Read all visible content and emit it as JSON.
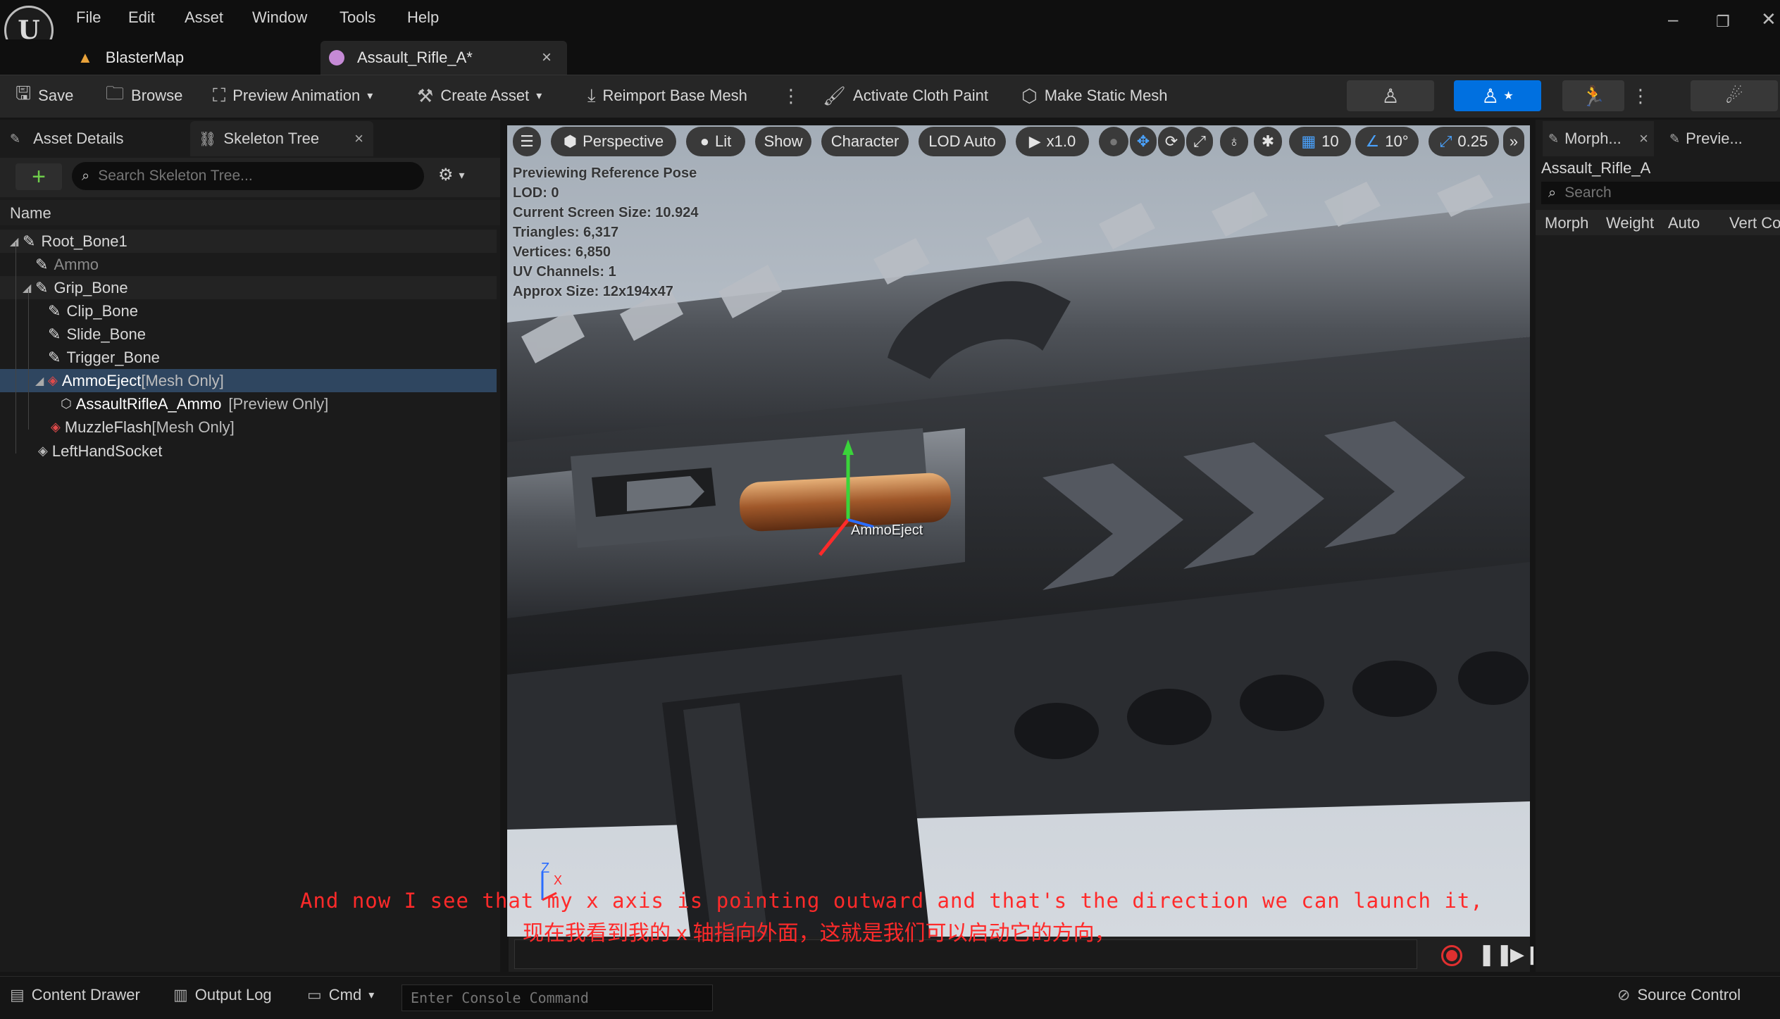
{
  "menu": [
    "File",
    "Edit",
    "Asset",
    "Window",
    "Tools",
    "Help"
  ],
  "tabs": {
    "map": "BlasterMap",
    "asset": "Assault_Rifle_A*",
    "close": "×"
  },
  "toolbar": {
    "save": "Save",
    "browse": "Browse",
    "preview_animation": "Preview Animation",
    "create_asset": "Create Asset",
    "reimport": "Reimport Base Mesh",
    "cloth_paint": "Activate Cloth Paint",
    "static_mesh": "Make Static Mesh"
  },
  "left_panel": {
    "asset_details_tab": "Asset Details",
    "skeleton_tree_tab": "Skeleton Tree",
    "search_placeholder": "Search Skeleton Tree...",
    "column_name": "Name",
    "tree": [
      {
        "label": "Root_Bone1"
      },
      {
        "label": "Ammo"
      },
      {
        "label": "Grip_Bone"
      },
      {
        "label": "Clip_Bone"
      },
      {
        "label": "Slide_Bone"
      },
      {
        "label": "Trigger_Bone"
      },
      {
        "label": "AmmoEject",
        "tag": "[Mesh Only]"
      },
      {
        "label": "AssaultRifleA_Ammo",
        "tag": "[Preview Only]"
      },
      {
        "label": "MuzzleFlash",
        "tag": "[Mesh Only]"
      },
      {
        "label": "LeftHandSocket"
      }
    ]
  },
  "viewport": {
    "toolbar": {
      "perspective": "Perspective",
      "lit": "Lit",
      "show": "Show",
      "character": "Character",
      "lod": "LOD Auto",
      "speed": "x1.0",
      "grid_snap": "10",
      "rot_snap": "10°",
      "scale_snap": "0.25"
    },
    "stats": [
      "Previewing Reference Pose",
      "LOD: 0",
      "Current Screen Size: 10.924",
      "Triangles: 6,317",
      "Vertices: 6,850",
      "UV Channels: 1",
      "Approx Size: 12x194x47"
    ],
    "gizmo_label": "AmmoEject",
    "axis_z": "Z",
    "axis_x": "X"
  },
  "subtitles": {
    "english": "And now I see that my x axis is pointing outward and that's the direction we can launch it,",
    "chinese": "现在我看到我的 x 轴指向外面，这就是我们可以启动它的方向，"
  },
  "right_panel": {
    "morph_tab": "Morph...",
    "preview_tab": "Previe...",
    "asset_name": "Assault_Rifle_A",
    "search_placeholder": "Search",
    "columns": [
      "Morph",
      "Weight",
      "Auto",
      "Vert Co"
    ]
  },
  "statusbar": {
    "content_drawer": "Content Drawer",
    "output_log": "Output Log",
    "cmd": "Cmd",
    "console_placeholder": "Enter Console Command",
    "source_control": "Source Control"
  },
  "colors": {
    "accent_blue": "#0070e0",
    "subtitle_red": "#ff2a2a",
    "selection": "#2f4660"
  }
}
